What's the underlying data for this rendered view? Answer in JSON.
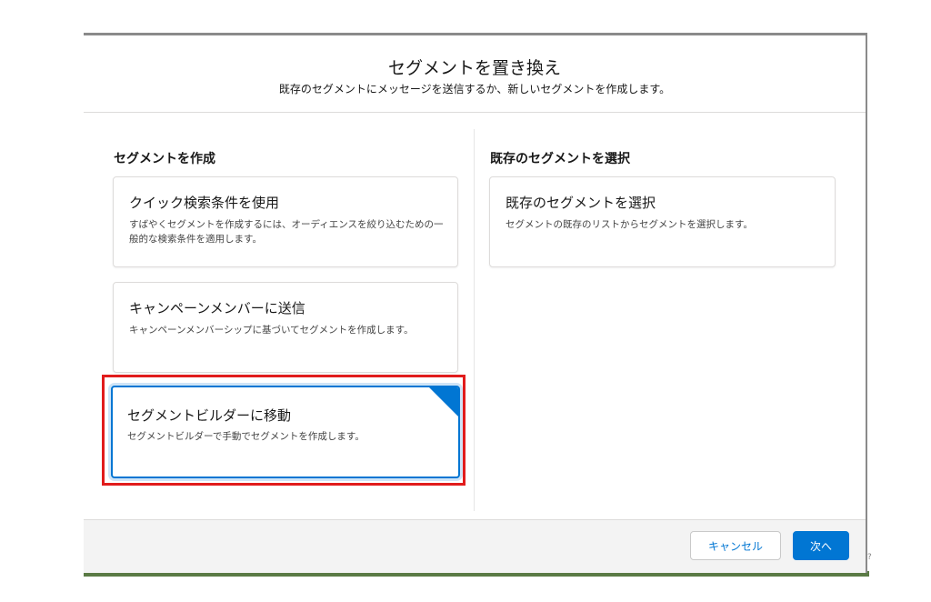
{
  "modal": {
    "title": "セグメントを置き換え",
    "subtitle": "既存のセグメントにメッセージを送信するか、新しいセグメントを作成します。"
  },
  "create_section": {
    "title": "セグメントを作成",
    "options": [
      {
        "title": "クイック検索条件を使用",
        "desc": "すばやくセグメントを作成するには、オーディエンスを絞り込むための一般的な検索条件を適用します。"
      },
      {
        "title": "キャンペーンメンバーに送信",
        "desc": "キャンペーンメンバーシップに基づいてセグメントを作成します。"
      },
      {
        "title": "セグメントビルダーに移動",
        "desc": "セグメントビルダーで手動でセグメントを作成します。"
      }
    ]
  },
  "existing_section": {
    "title": "既存のセグメントを選択",
    "option": {
      "title": "既存のセグメントを選択",
      "desc": "セグメントの既存のリストからセグメントを選択します。"
    }
  },
  "footer": {
    "cancel_label": "キャンセル",
    "next_label": "次へ"
  },
  "colors": {
    "brand": "#0176d3",
    "highlight": "#e11c1c"
  },
  "edge_mark": "?"
}
